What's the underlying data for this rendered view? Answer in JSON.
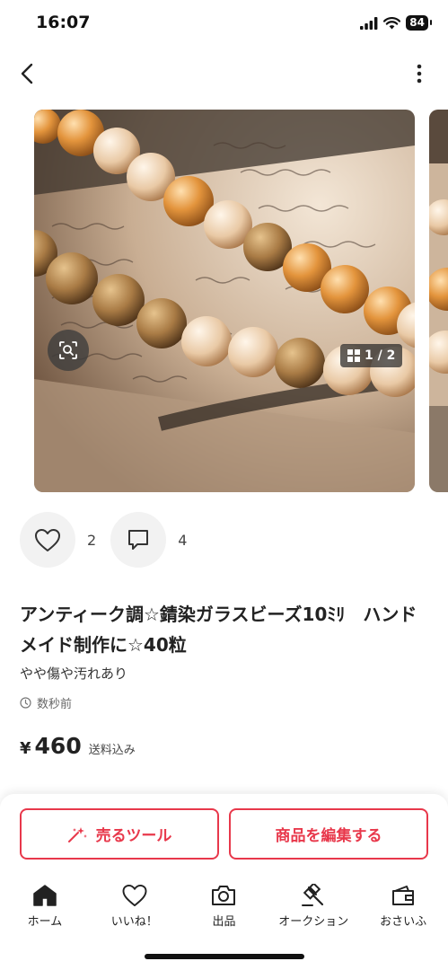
{
  "status_bar": {
    "time": "16:07",
    "battery": "84"
  },
  "product": {
    "title": "アンティーク調☆錆染ガラスビーズ10ﾐﾘ　ハンドメイド制作に☆40粒",
    "condition": "やや傷や汚れあり",
    "posted_time": "数秒前",
    "price_symbol": "¥",
    "price": "460",
    "shipping_note": "送料込み",
    "photo_counter": "1 / 2",
    "likes_count": "2",
    "comments_count": "4"
  },
  "actions": {
    "sell_tool": "売るツール",
    "edit_item": "商品を編集する"
  },
  "tabbar": [
    {
      "label": "ホーム",
      "icon": "home-icon"
    },
    {
      "label": "いいね！",
      "icon": "heart-icon"
    },
    {
      "label": "出品",
      "icon": "camera-icon"
    },
    {
      "label": "オークション",
      "icon": "gavel-icon"
    },
    {
      "label": "おさいふ",
      "icon": "wallet-icon"
    }
  ],
  "colors": {
    "accent": "#e8384b",
    "text": "#222222"
  }
}
